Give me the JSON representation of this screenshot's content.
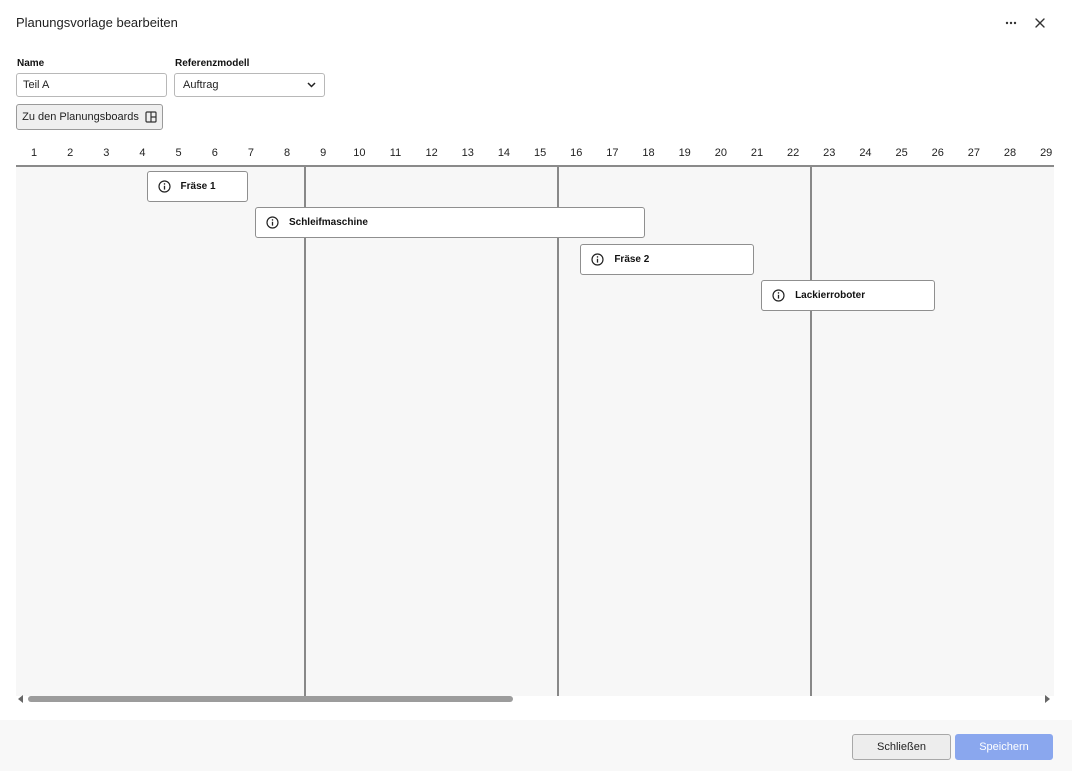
{
  "dialog": {
    "title": "Planungsvorlage bearbeiten"
  },
  "form": {
    "name_label": "Name",
    "name_value": "Teil A",
    "ref_label": "Referenzmodell",
    "ref_value": "Auftrag",
    "boards_button": "Zu den Planungsboards"
  },
  "timeline": {
    "ticks": [
      "1",
      "2",
      "3",
      "4",
      "5",
      "6",
      "7",
      "8",
      "9",
      "10",
      "11",
      "12",
      "13",
      "14",
      "15",
      "16",
      "17",
      "18",
      "19",
      "20",
      "21",
      "22",
      "23",
      "24",
      "25",
      "26",
      "27",
      "28",
      "29"
    ],
    "tasks": [
      {
        "label": "Fräse 1",
        "start": 4,
        "end": 6.8,
        "row": 0
      },
      {
        "label": "Schleifmaschine",
        "start": 7,
        "end": 17.8,
        "row": 1
      },
      {
        "label": "Fräse 2",
        "start": 16,
        "end": 20.8,
        "row": 2
      },
      {
        "label": "Lackierroboter",
        "start": 21,
        "end": 25.8,
        "row": 3
      }
    ],
    "separators": [
      8,
      15,
      22,
      29
    ],
    "scroll_fraction": 0.48
  },
  "footer": {
    "close_label": "Schließen",
    "save_label": "Speichern"
  },
  "colors": {
    "accent": "#8aa7ee",
    "grid_bg": "#f7f7f7",
    "line": "#888888"
  }
}
